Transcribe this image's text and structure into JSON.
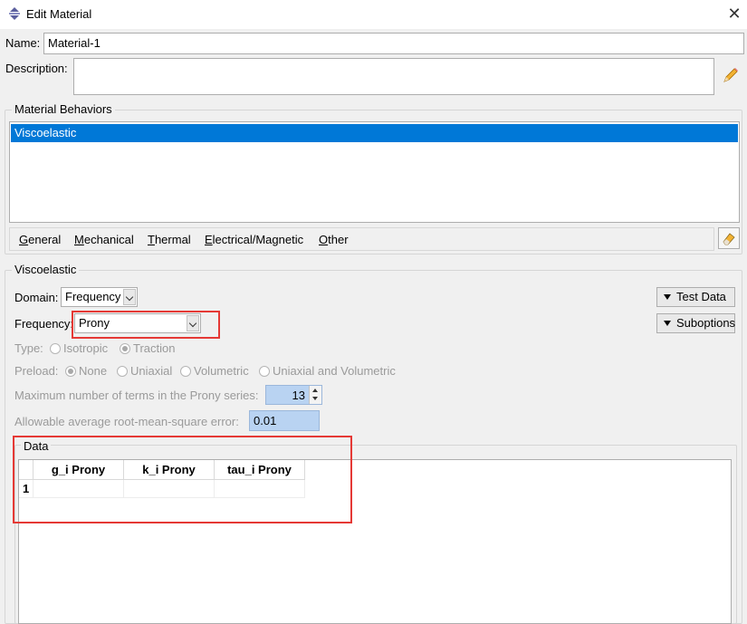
{
  "window": {
    "title": "Edit Material"
  },
  "name_field": {
    "label": "Name:",
    "value": "Material-1"
  },
  "description_field": {
    "label": "Description:",
    "value": ""
  },
  "behaviors": {
    "group_title": "Material Behaviors",
    "items": [
      "Viscoelastic"
    ],
    "selected": "Viscoelastic"
  },
  "menu": {
    "items": [
      {
        "accel": "G",
        "rest": "eneral"
      },
      {
        "accel": "M",
        "rest": "echanical"
      },
      {
        "accel": "T",
        "rest": "hermal"
      },
      {
        "accel": "E",
        "rest": "lectrical/Magnetic"
      },
      {
        "accel": "O",
        "rest": "ther"
      }
    ]
  },
  "viscoelastic": {
    "group_title": "Viscoelastic",
    "domain": {
      "label": "Domain:",
      "value": "Frequency"
    },
    "frequency": {
      "label": "Frequency:",
      "value": "Prony"
    },
    "test_data_button": "Test Data",
    "suboptions_button": "Suboptions",
    "type": {
      "label": "Type:",
      "options": [
        "Isotropic",
        "Traction"
      ],
      "selected": "Traction"
    },
    "preload": {
      "label": "Preload:",
      "options": [
        "None",
        "Uniaxial",
        "Volumetric",
        "Uniaxial and Volumetric"
      ],
      "selected": "None"
    },
    "max_terms": {
      "label": "Maximum number of terms in the Prony series:",
      "value": "13"
    },
    "rms_error": {
      "label": "Allowable average root-mean-square error:",
      "value": "0.01"
    }
  },
  "data": {
    "group_title": "Data",
    "columns": [
      "g_i Prony",
      "k_i Prony",
      "tau_i Prony"
    ],
    "rows": [
      {
        "num": "1",
        "cells": [
          "",
          "",
          ""
        ]
      }
    ]
  },
  "colors": {
    "selection": "#0078d7",
    "highlight_box": "#e53935",
    "edit_field": "#b9d3f2"
  }
}
